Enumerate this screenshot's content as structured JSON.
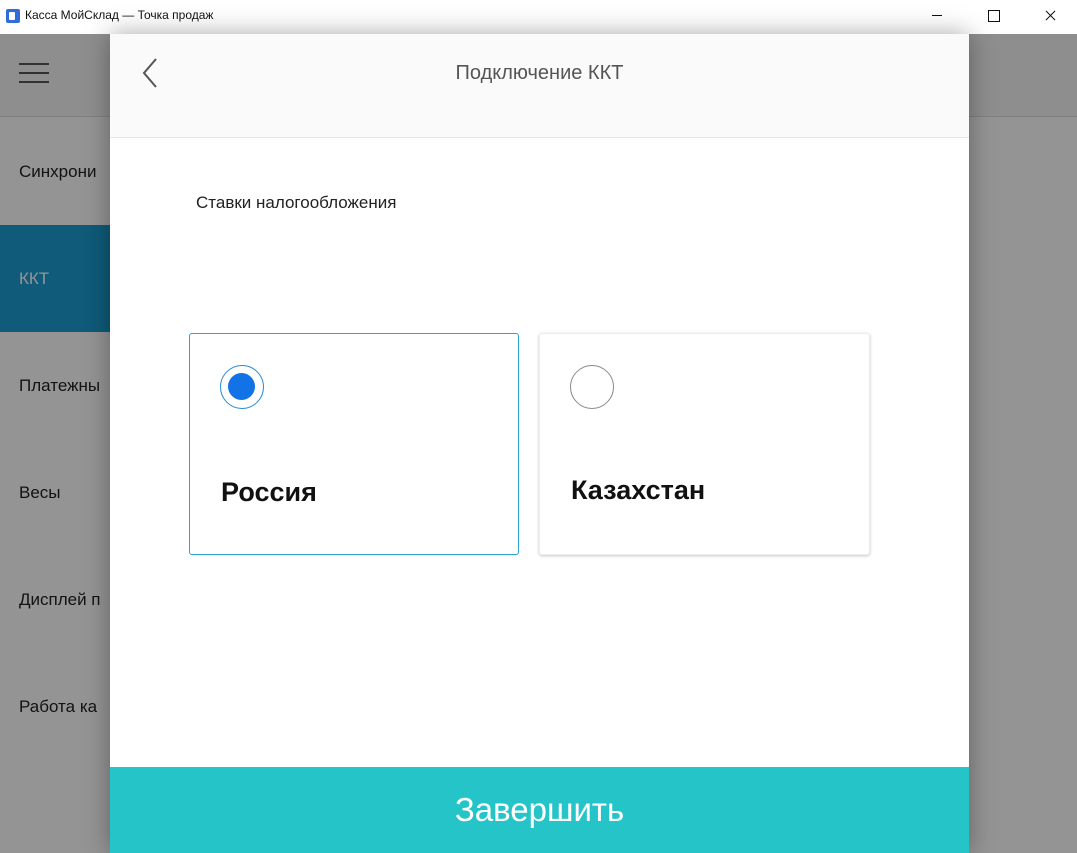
{
  "window": {
    "title": "Касса МойСклад — Точка продаж"
  },
  "background": {
    "menu": [
      {
        "label": "Синхрони",
        "active": false
      },
      {
        "label": "ККТ",
        "active": true
      },
      {
        "label": "Платежны",
        "active": false
      },
      {
        "label": "Весы",
        "active": false
      },
      {
        "label": "Дисплей п",
        "active": false
      },
      {
        "label": "Работа ка",
        "active": false
      }
    ]
  },
  "dialog": {
    "title": "Подключение ККТ",
    "section_label": "Ставки налогообложения",
    "options": [
      {
        "label": "Россия",
        "selected": true
      },
      {
        "label": "Казахстан",
        "selected": false
      }
    ],
    "finish_label": "Завершить"
  },
  "colors": {
    "accent": "#24c4c9",
    "radio_selected": "#1273e6",
    "selected_border": "#2aa3cf",
    "menu_active": "#1a9ed0"
  }
}
